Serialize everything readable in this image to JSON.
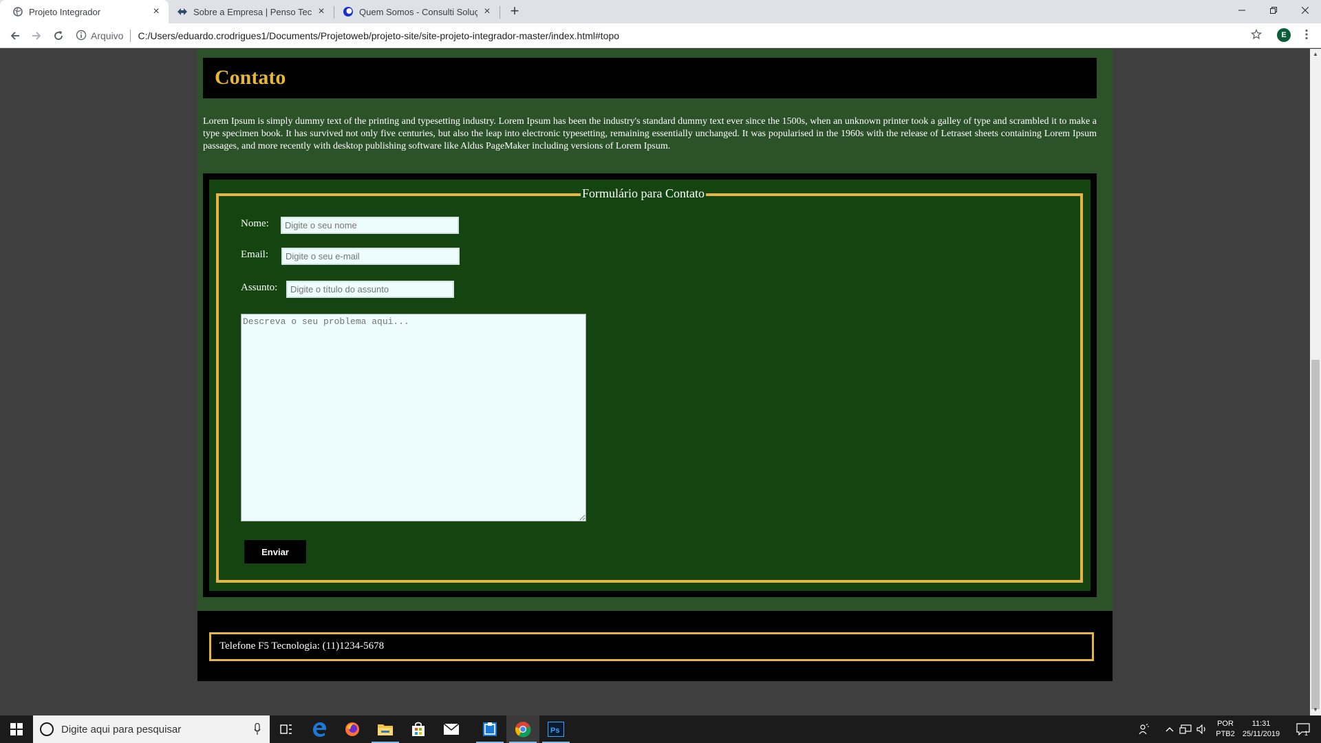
{
  "browser": {
    "tabs": [
      {
        "title": "Projeto Integrador",
        "active": true
      },
      {
        "title": "Sobre a Empresa | Penso Tecnologia",
        "active": false
      },
      {
        "title": "Quem Somos - Consulti Soluções",
        "active": false
      }
    ],
    "new_tab_label": "+",
    "site_info": "Arquivo",
    "url": "C:/Users/eduardo.crodrigues1/Documents/Projetoweb/projeto-site/site-projeto-integrador-master/index.html#topo",
    "profile_initial": "E"
  },
  "page": {
    "contato_title": "Contato",
    "contato_text": "Lorem Ipsum is simply dummy text of the printing and typesetting industry. Lorem Ipsum has been the industry's standard dummy text ever since the 1500s, when an unknown printer took a galley of type and scrambled it to make a type specimen book. It has survived not only five centuries, but also the leap into electronic typesetting, remaining essentially unchanged. It was popularised in the 1960s with the release of Letraset sheets containing Lorem Ipsum passages, and more recently with desktop publishing software like Aldus PageMaker including versions of Lorem Ipsum.",
    "form": {
      "legend": "Formulário para Contato",
      "nome_label": "Nome:",
      "nome_placeholder": "Digite o seu nome",
      "email_label": "Email:",
      "email_placeholder": "Digite o seu e-mail",
      "assunto_label": "Assunto:",
      "assunto_placeholder": "Digite o título do assunto",
      "message_placeholder": "Descreva o seu problema aqui...",
      "submit_label": "Enviar"
    },
    "footer_text": "Telefone F5 Tecnologia: (11)1234-5678"
  },
  "taskbar": {
    "search_placeholder": "Digite aqui para pesquisar",
    "lang_line1": "POR",
    "lang_line2": "PTB2",
    "time": "11:31",
    "date": "25/11/2019",
    "notification_count": "1",
    "apps": [
      "task-view",
      "edge",
      "firefox",
      "file-explorer",
      "store",
      "mail",
      "app-window",
      "chrome",
      "photoshop"
    ]
  },
  "colors": {
    "accent_gold": "#e7b53a",
    "page_green": "#2b5228",
    "form_green": "#144410",
    "input_bg": "#edfdfd"
  }
}
